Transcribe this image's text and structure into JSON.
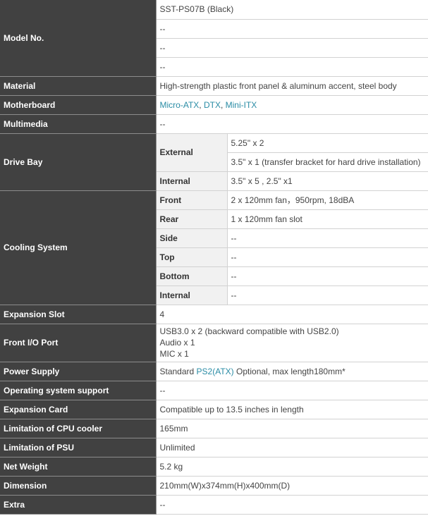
{
  "rows": {
    "model": {
      "label": "Model No.",
      "values": [
        "SST-PS07B (Black)",
        "--",
        "--",
        "--"
      ]
    },
    "material": {
      "label": "Material",
      "value": "High-strength plastic front panel & aluminum accent, steel body"
    },
    "motherboard": {
      "label": "Motherboard",
      "links": [
        "Micro-ATX",
        "DTX",
        "Mini-ITX"
      ],
      "sep": ", "
    },
    "multimedia": {
      "label": "Multimedia",
      "value": "--"
    },
    "drive_bay": {
      "label": "Drive Bay",
      "external_label": "External",
      "external_values": [
        "5.25\" x 2",
        "3.5\" x 1 (transfer bracket for hard drive installation)"
      ],
      "internal_label": "Internal",
      "internal_value": "3.5\" x 5 , 2.5\" x1"
    },
    "cooling": {
      "label": "Cooling System",
      "items": [
        {
          "label": "Front",
          "value": "2 x 120mm fan，950rpm, 18dBA"
        },
        {
          "label": "Rear",
          "value": "1 x 120mm fan slot"
        },
        {
          "label": "Side",
          "value": "--"
        },
        {
          "label": "Top",
          "value": "--"
        },
        {
          "label": "Bottom",
          "value": "--"
        },
        {
          "label": "Internal",
          "value": "--"
        }
      ]
    },
    "expansion_slot": {
      "label": "Expansion Slot",
      "value": "4"
    },
    "front_io": {
      "label": "Front I/O Port",
      "lines": [
        "USB3.0 x 2 (backward compatible with USB2.0)",
        "Audio x 1",
        "MIC x 1"
      ]
    },
    "power_supply": {
      "label": "Power Supply",
      "prefix": "Standard ",
      "link": "PS2(ATX)",
      "suffix": " Optional, max length180mm*"
    },
    "os_support": {
      "label": "Operating system support",
      "value": "--"
    },
    "expansion_card": {
      "label": "Expansion Card",
      "value": "Compatible up to 13.5 inches in length"
    },
    "cpu_cooler": {
      "label": "Limitation of CPU cooler",
      "value": "165mm"
    },
    "psu_limit": {
      "label": "Limitation of PSU",
      "value": "Unlimited"
    },
    "net_weight": {
      "label": "Net Weight",
      "value": "5.2 kg"
    },
    "dimension": {
      "label": "Dimension",
      "value": "210mm(W)x374mm(H)x400mm(D)"
    },
    "extra": {
      "label": "Extra",
      "value": "--"
    }
  }
}
